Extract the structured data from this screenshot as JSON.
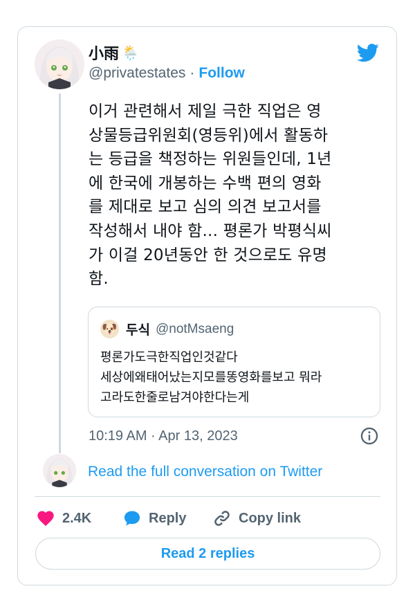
{
  "tweet": {
    "author": {
      "display_name": "小雨",
      "name_emoji": "🌦️",
      "handle": "@privatestates",
      "separator": "·",
      "follow_label": "Follow",
      "avatar": "anime-avatar"
    },
    "brand_icon": "twitter-bird-icon",
    "brand_color": "#1d9bf0",
    "text_lines": [
      "이거 관련해서 제일 극한 직업은 영",
      "상물등급위원회(영등위)에서 활동하",
      "는 등급을 책정하는 위원들인데, 1년",
      "에 한국에 개봉하는 수백 편의 영화",
      "를 제대로 보고 심의 의견 보고서를",
      "작성해서 내야 함... 평론가 박평식씨",
      "가 이걸 20년동안 한 것으로도 유명",
      "함."
    ],
    "quote": {
      "emoji": "🐶",
      "name": "두식",
      "handle": "@notMsaeng",
      "text_lines": [
        "평론가도극한직업인것같다",
        "세상에왜태어났는지모를똥영화를보고 뭐라",
        "고라도한줄로남겨야한다는게"
      ]
    },
    "timestamp": "10:19 AM · Apr 13, 2023",
    "info_icon": "info-icon"
  },
  "conversation_link": "Read the full conversation on Twitter",
  "actions": {
    "like_count": "2.4K",
    "like_color": "#f91880",
    "reply_label": "Reply",
    "copy_link_label": "Copy link"
  },
  "read_replies_label": "Read 2 replies"
}
